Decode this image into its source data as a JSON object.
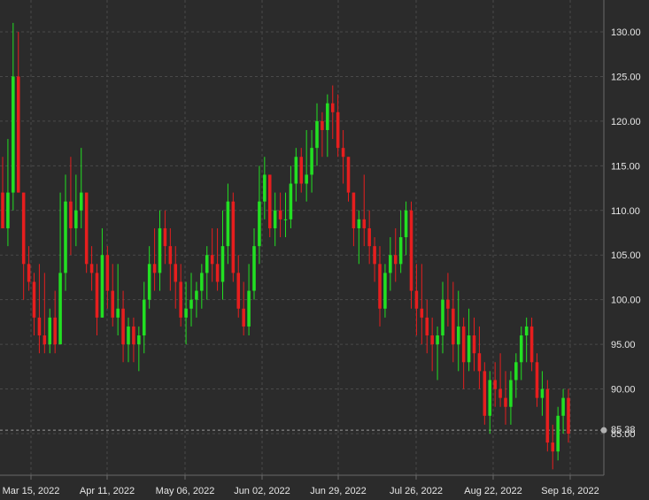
{
  "chart_data": {
    "type": "candlestick",
    "title": "",
    "xlabel": "",
    "ylabel": "",
    "ylim": [
      80,
      132
    ],
    "y_ticks": [
      "130.00",
      "125.00",
      "120.00",
      "115.00",
      "110.00",
      "105.00",
      "100.00",
      "95.00",
      "90.00",
      "85.00"
    ],
    "y_tick_values": [
      130,
      125,
      120,
      115,
      110,
      105,
      100,
      95,
      90,
      85
    ],
    "x_ticks": [
      "Mar 15, 2022",
      "Apr 11, 2022",
      "May 06, 2022",
      "Jun 02, 2022",
      "Jun 29, 2022",
      "Jul 26, 2022",
      "Aug 22, 2022",
      "Sep 16, 2022"
    ],
    "grid": true,
    "last_price": "85.38",
    "last_price_value": 85.38,
    "colors": {
      "up": "#22e022",
      "down": "#e61e1e",
      "background": "#2b2b2b"
    },
    "candles": [
      [
        112,
        116,
        108,
        108
      ],
      [
        108,
        118,
        106,
        112
      ],
      [
        112,
        131,
        110,
        125
      ],
      [
        125,
        130,
        112,
        112
      ],
      [
        112,
        112,
        100,
        104
      ],
      [
        104,
        106,
        101,
        102
      ],
      [
        102,
        103,
        96,
        98
      ],
      [
        98,
        104,
        94,
        96
      ],
      [
        96,
        103,
        94,
        95
      ],
      [
        95,
        99,
        94,
        98
      ],
      [
        98,
        101,
        94,
        95
      ],
      [
        95,
        112,
        96,
        103
      ],
      [
        103,
        114,
        101,
        111
      ],
      [
        111,
        116,
        105,
        108
      ],
      [
        108,
        114,
        106,
        110
      ],
      [
        110,
        117,
        108,
        112
      ],
      [
        112,
        112,
        103,
        104
      ],
      [
        104,
        106,
        101,
        103
      ],
      [
        103,
        104,
        96,
        98
      ],
      [
        98,
        108,
        98,
        105
      ],
      [
        105,
        106,
        99,
        101
      ],
      [
        101,
        104,
        97,
        98
      ],
      [
        98,
        104,
        96,
        99
      ],
      [
        99,
        101,
        93,
        95
      ],
      [
        95,
        98,
        93,
        97
      ],
      [
        97,
        98,
        93,
        95
      ],
      [
        95,
        97,
        92,
        96
      ],
      [
        96,
        102,
        94,
        100
      ],
      [
        100,
        106,
        99,
        104
      ],
      [
        104,
        108,
        101,
        103
      ],
      [
        103,
        110,
        101,
        108
      ],
      [
        108,
        110,
        104,
        106
      ],
      [
        106,
        108,
        101,
        104
      ],
      [
        104,
        106,
        99,
        102
      ],
      [
        102,
        104,
        97,
        98
      ],
      [
        98,
        102,
        95,
        99
      ],
      [
        99,
        103,
        97,
        100
      ],
      [
        100,
        102,
        98,
        101
      ],
      [
        101,
        104,
        99,
        103
      ],
      [
        103,
        106,
        100,
        105
      ],
      [
        105,
        108,
        102,
        104
      ],
      [
        104,
        108,
        101,
        102
      ],
      [
        102,
        110,
        100,
        106
      ],
      [
        106,
        113,
        104,
        111
      ],
      [
        111,
        112,
        102,
        103
      ],
      [
        103,
        105,
        98,
        99
      ],
      [
        99,
        102,
        96,
        97
      ],
      [
        97,
        104,
        96,
        101
      ],
      [
        101,
        108,
        100,
        106
      ],
      [
        106,
        115,
        104,
        111
      ],
      [
        111,
        116,
        109,
        114
      ],
      [
        114,
        114,
        107,
        108
      ],
      [
        108,
        112,
        106,
        110
      ],
      [
        110,
        112,
        107,
        109
      ],
      [
        109,
        112,
        107,
        109
      ],
      [
        109,
        115,
        108,
        113
      ],
      [
        113,
        117,
        111,
        116
      ],
      [
        116,
        117,
        112,
        113
      ],
      [
        113,
        119,
        111,
        114
      ],
      [
        114,
        119,
        112,
        117
      ],
      [
        117,
        122,
        115,
        120
      ],
      [
        120,
        121,
        116,
        119
      ],
      [
        119,
        123,
        116,
        122
      ],
      [
        122,
        124,
        118,
        121
      ],
      [
        121,
        123,
        116,
        117
      ],
      [
        117,
        119,
        113,
        116
      ],
      [
        116,
        116,
        111,
        112
      ],
      [
        112,
        112,
        106,
        108
      ],
      [
        108,
        110,
        104,
        109
      ],
      [
        109,
        114,
        106,
        108
      ],
      [
        108,
        110,
        104,
        106
      ],
      [
        106,
        107,
        102,
        104
      ],
      [
        104,
        106,
        97,
        99
      ],
      [
        99,
        104,
        98,
        103
      ],
      [
        103,
        107,
        101,
        105
      ],
      [
        105,
        108,
        102,
        104
      ],
      [
        104,
        110,
        103,
        107
      ],
      [
        107,
        111,
        105,
        110
      ],
      [
        110,
        111,
        99,
        101
      ],
      [
        101,
        104,
        96,
        99
      ],
      [
        99,
        104,
        95,
        98
      ],
      [
        98,
        100,
        94,
        96
      ],
      [
        96,
        98,
        92,
        95
      ],
      [
        95,
        97,
        91,
        96
      ],
      [
        96,
        102,
        94,
        100
      ],
      [
        100,
        103,
        97,
        99
      ],
      [
        99,
        102,
        93,
        95
      ],
      [
        95,
        101,
        92,
        97
      ],
      [
        97,
        98,
        90,
        93
      ],
      [
        93,
        99,
        92,
        96
      ],
      [
        96,
        98,
        92,
        94
      ],
      [
        94,
        97,
        90,
        92
      ],
      [
        92,
        93,
        86,
        87
      ],
      [
        87,
        92,
        85,
        91
      ],
      [
        91,
        93,
        88,
        90
      ],
      [
        90,
        94,
        88,
        89
      ],
      [
        89,
        92,
        86,
        88
      ],
      [
        88,
        92,
        86,
        91
      ],
      [
        91,
        94,
        89,
        93
      ],
      [
        93,
        97,
        91,
        96
      ],
      [
        96,
        98,
        93,
        97
      ],
      [
        97,
        98,
        92,
        93
      ],
      [
        93,
        94,
        88,
        89
      ],
      [
        89,
        92,
        87,
        90
      ],
      [
        90,
        91,
        83,
        84
      ],
      [
        84,
        86,
        81,
        83
      ],
      [
        83,
        88,
        82,
        87
      ],
      [
        87,
        90,
        85,
        89
      ],
      [
        89,
        90,
        84,
        85
      ]
    ]
  }
}
